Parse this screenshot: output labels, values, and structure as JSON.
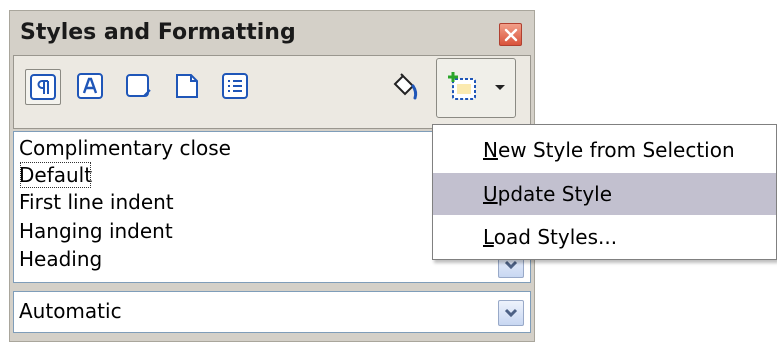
{
  "panel": {
    "title": "Styles and Formatting"
  },
  "toolbar": {
    "buttons": [
      {
        "icon": "paragraph-styles-icon"
      },
      {
        "icon": "character-styles-icon"
      },
      {
        "icon": "frame-styles-icon"
      },
      {
        "icon": "page-styles-icon"
      },
      {
        "icon": "list-styles-icon"
      },
      {
        "icon": "fill-format-mode-icon"
      },
      {
        "icon": "new-style-from-selection-icon"
      }
    ]
  },
  "style_list": {
    "items": [
      {
        "label": "Complimentary close"
      },
      {
        "label": "Default",
        "selected": true
      },
      {
        "label": "First line indent"
      },
      {
        "label": "Hanging indent"
      },
      {
        "label": "Heading"
      }
    ]
  },
  "filter": {
    "value": "Automatic"
  },
  "menu": {
    "items": [
      {
        "mnemonic": "N",
        "rest": "ew Style from Selection"
      },
      {
        "mnemonic": "U",
        "rest": "pdate Style",
        "hover": true
      },
      {
        "mnemonic": "L",
        "rest": "oad Styles..."
      }
    ]
  },
  "colors": {
    "panel_bg": "#d4d0c8",
    "menu_hover": "#c2c0cf",
    "close_red": "#d9533b",
    "icon_blue": "#1f56b8"
  }
}
